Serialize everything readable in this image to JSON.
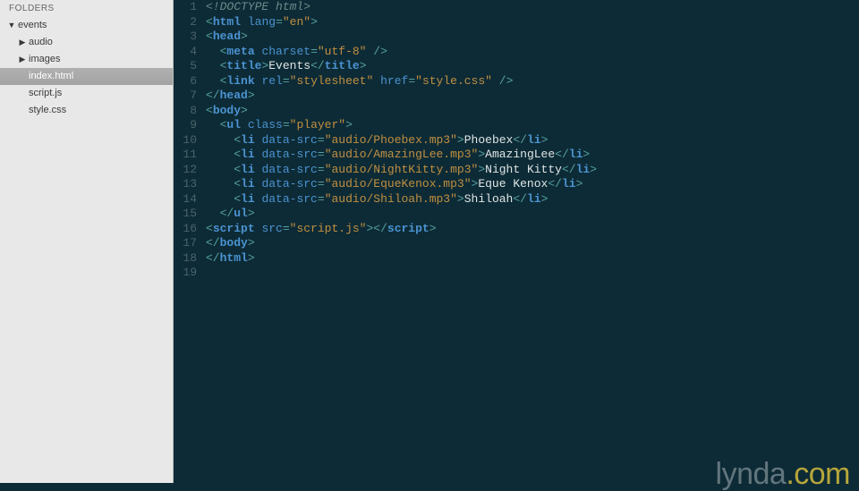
{
  "sidebar": {
    "header": "FOLDERS",
    "tree": [
      {
        "indent": 0,
        "arrow": "▼",
        "label": "events",
        "selected": false,
        "interact": true
      },
      {
        "indent": 1,
        "arrow": "▶",
        "label": "audio",
        "selected": false,
        "interact": true
      },
      {
        "indent": 1,
        "arrow": "▶",
        "label": "images",
        "selected": false,
        "interact": true
      },
      {
        "indent": 1,
        "arrow": "",
        "label": "index.html",
        "selected": true,
        "interact": true
      },
      {
        "indent": 1,
        "arrow": "",
        "label": "script.js",
        "selected": false,
        "interact": true
      },
      {
        "indent": 1,
        "arrow": "",
        "label": "style.css",
        "selected": false,
        "interact": true
      }
    ]
  },
  "editor": {
    "lines": [
      [
        {
          "c": "dt",
          "t": "<!DOCTYPE html>"
        }
      ],
      [
        {
          "c": "p",
          "t": "<"
        },
        {
          "c": "tg",
          "t": "html"
        },
        {
          "c": "tx",
          "t": " "
        },
        {
          "c": "at",
          "t": "lang"
        },
        {
          "c": "p",
          "t": "="
        },
        {
          "c": "st",
          "t": "\"en\""
        },
        {
          "c": "p",
          "t": ">"
        }
      ],
      [
        {
          "c": "p",
          "t": "<"
        },
        {
          "c": "tg",
          "t": "head"
        },
        {
          "c": "p",
          "t": ">"
        }
      ],
      [
        {
          "c": "tx",
          "t": "  "
        },
        {
          "c": "p",
          "t": "<"
        },
        {
          "c": "tg",
          "t": "meta"
        },
        {
          "c": "tx",
          "t": " "
        },
        {
          "c": "at",
          "t": "charset"
        },
        {
          "c": "p",
          "t": "="
        },
        {
          "c": "st",
          "t": "\"utf-8\""
        },
        {
          "c": "tx",
          "t": " "
        },
        {
          "c": "p",
          "t": "/>"
        }
      ],
      [
        {
          "c": "tx",
          "t": "  "
        },
        {
          "c": "p",
          "t": "<"
        },
        {
          "c": "tg",
          "t": "title"
        },
        {
          "c": "p",
          "t": ">"
        },
        {
          "c": "tx",
          "t": "Events"
        },
        {
          "c": "p",
          "t": "</"
        },
        {
          "c": "tg",
          "t": "title"
        },
        {
          "c": "p",
          "t": ">"
        }
      ],
      [
        {
          "c": "tx",
          "t": "  "
        },
        {
          "c": "p",
          "t": "<"
        },
        {
          "c": "tg",
          "t": "link"
        },
        {
          "c": "tx",
          "t": " "
        },
        {
          "c": "at",
          "t": "rel"
        },
        {
          "c": "p",
          "t": "="
        },
        {
          "c": "st",
          "t": "\"stylesheet\""
        },
        {
          "c": "tx",
          "t": " "
        },
        {
          "c": "at",
          "t": "href"
        },
        {
          "c": "p",
          "t": "="
        },
        {
          "c": "st",
          "t": "\"style.css\""
        },
        {
          "c": "tx",
          "t": " "
        },
        {
          "c": "p",
          "t": "/>"
        }
      ],
      [
        {
          "c": "p",
          "t": "</"
        },
        {
          "c": "tg",
          "t": "head"
        },
        {
          "c": "p",
          "t": ">"
        }
      ],
      [
        {
          "c": "p",
          "t": "<"
        },
        {
          "c": "tg",
          "t": "body"
        },
        {
          "c": "p",
          "t": ">"
        }
      ],
      [
        {
          "c": "tx",
          "t": "  "
        },
        {
          "c": "p",
          "t": "<"
        },
        {
          "c": "tg",
          "t": "ul"
        },
        {
          "c": "tx",
          "t": " "
        },
        {
          "c": "at",
          "t": "class"
        },
        {
          "c": "p",
          "t": "="
        },
        {
          "c": "st",
          "t": "\"player\""
        },
        {
          "c": "p",
          "t": ">"
        }
      ],
      [
        {
          "c": "tx",
          "t": "    "
        },
        {
          "c": "p",
          "t": "<"
        },
        {
          "c": "tg",
          "t": "li"
        },
        {
          "c": "tx",
          "t": " "
        },
        {
          "c": "at",
          "t": "data-src"
        },
        {
          "c": "p",
          "t": "="
        },
        {
          "c": "st",
          "t": "\"audio/Phoebex.mp3\""
        },
        {
          "c": "p",
          "t": ">"
        },
        {
          "c": "tx",
          "t": "Phoebex"
        },
        {
          "c": "p",
          "t": "</"
        },
        {
          "c": "tg",
          "t": "li"
        },
        {
          "c": "p",
          "t": ">"
        }
      ],
      [
        {
          "c": "tx",
          "t": "    "
        },
        {
          "c": "p",
          "t": "<"
        },
        {
          "c": "tg",
          "t": "li"
        },
        {
          "c": "tx",
          "t": " "
        },
        {
          "c": "at",
          "t": "data-src"
        },
        {
          "c": "p",
          "t": "="
        },
        {
          "c": "st",
          "t": "\"audio/AmazingLee.mp3\""
        },
        {
          "c": "p",
          "t": ">"
        },
        {
          "c": "tx",
          "t": "AmazingLee"
        },
        {
          "c": "p",
          "t": "</"
        },
        {
          "c": "tg",
          "t": "li"
        },
        {
          "c": "p",
          "t": ">"
        }
      ],
      [
        {
          "c": "tx",
          "t": "    "
        },
        {
          "c": "p",
          "t": "<"
        },
        {
          "c": "tg",
          "t": "li"
        },
        {
          "c": "tx",
          "t": " "
        },
        {
          "c": "at",
          "t": "data-src"
        },
        {
          "c": "p",
          "t": "="
        },
        {
          "c": "st",
          "t": "\"audio/NightKitty.mp3\""
        },
        {
          "c": "p",
          "t": ">"
        },
        {
          "c": "tx",
          "t": "Night Kitty"
        },
        {
          "c": "p",
          "t": "</"
        },
        {
          "c": "tg",
          "t": "li"
        },
        {
          "c": "p",
          "t": ">"
        }
      ],
      [
        {
          "c": "tx",
          "t": "    "
        },
        {
          "c": "p",
          "t": "<"
        },
        {
          "c": "tg",
          "t": "li"
        },
        {
          "c": "tx",
          "t": " "
        },
        {
          "c": "at",
          "t": "data-src"
        },
        {
          "c": "p",
          "t": "="
        },
        {
          "c": "st",
          "t": "\"audio/EqueKenox.mp3\""
        },
        {
          "c": "p",
          "t": ">"
        },
        {
          "c": "tx",
          "t": "Eque Kenox"
        },
        {
          "c": "p",
          "t": "</"
        },
        {
          "c": "tg",
          "t": "li"
        },
        {
          "c": "p",
          "t": ">"
        }
      ],
      [
        {
          "c": "tx",
          "t": "    "
        },
        {
          "c": "p",
          "t": "<"
        },
        {
          "c": "tg",
          "t": "li"
        },
        {
          "c": "tx",
          "t": " "
        },
        {
          "c": "at",
          "t": "data-src"
        },
        {
          "c": "p",
          "t": "="
        },
        {
          "c": "st",
          "t": "\"audio/Shiloah.mp3\""
        },
        {
          "c": "p",
          "t": ">"
        },
        {
          "c": "tx",
          "t": "Shiloah"
        },
        {
          "c": "p",
          "t": "</"
        },
        {
          "c": "tg",
          "t": "li"
        },
        {
          "c": "p",
          "t": ">"
        }
      ],
      [
        {
          "c": "tx",
          "t": "  "
        },
        {
          "c": "p",
          "t": "</"
        },
        {
          "c": "tg",
          "t": "ul"
        },
        {
          "c": "p",
          "t": ">"
        }
      ],
      [
        {
          "c": "p",
          "t": "<"
        },
        {
          "c": "tg",
          "t": "script"
        },
        {
          "c": "tx",
          "t": " "
        },
        {
          "c": "at",
          "t": "src"
        },
        {
          "c": "p",
          "t": "="
        },
        {
          "c": "st",
          "t": "\"script.js\""
        },
        {
          "c": "p",
          "t": ">"
        },
        {
          "c": "p",
          "t": "</"
        },
        {
          "c": "tg",
          "t": "script"
        },
        {
          "c": "p",
          "t": ">"
        }
      ],
      [
        {
          "c": "p",
          "t": "</"
        },
        {
          "c": "tg",
          "t": "body"
        },
        {
          "c": "p",
          "t": ">"
        }
      ],
      [
        {
          "c": "p",
          "t": "</"
        },
        {
          "c": "tg",
          "t": "html"
        },
        {
          "c": "p",
          "t": ">"
        }
      ],
      [
        {
          "c": "tx",
          "t": ""
        }
      ]
    ]
  },
  "watermark": {
    "text": "lynda",
    "suffix": ".com"
  }
}
